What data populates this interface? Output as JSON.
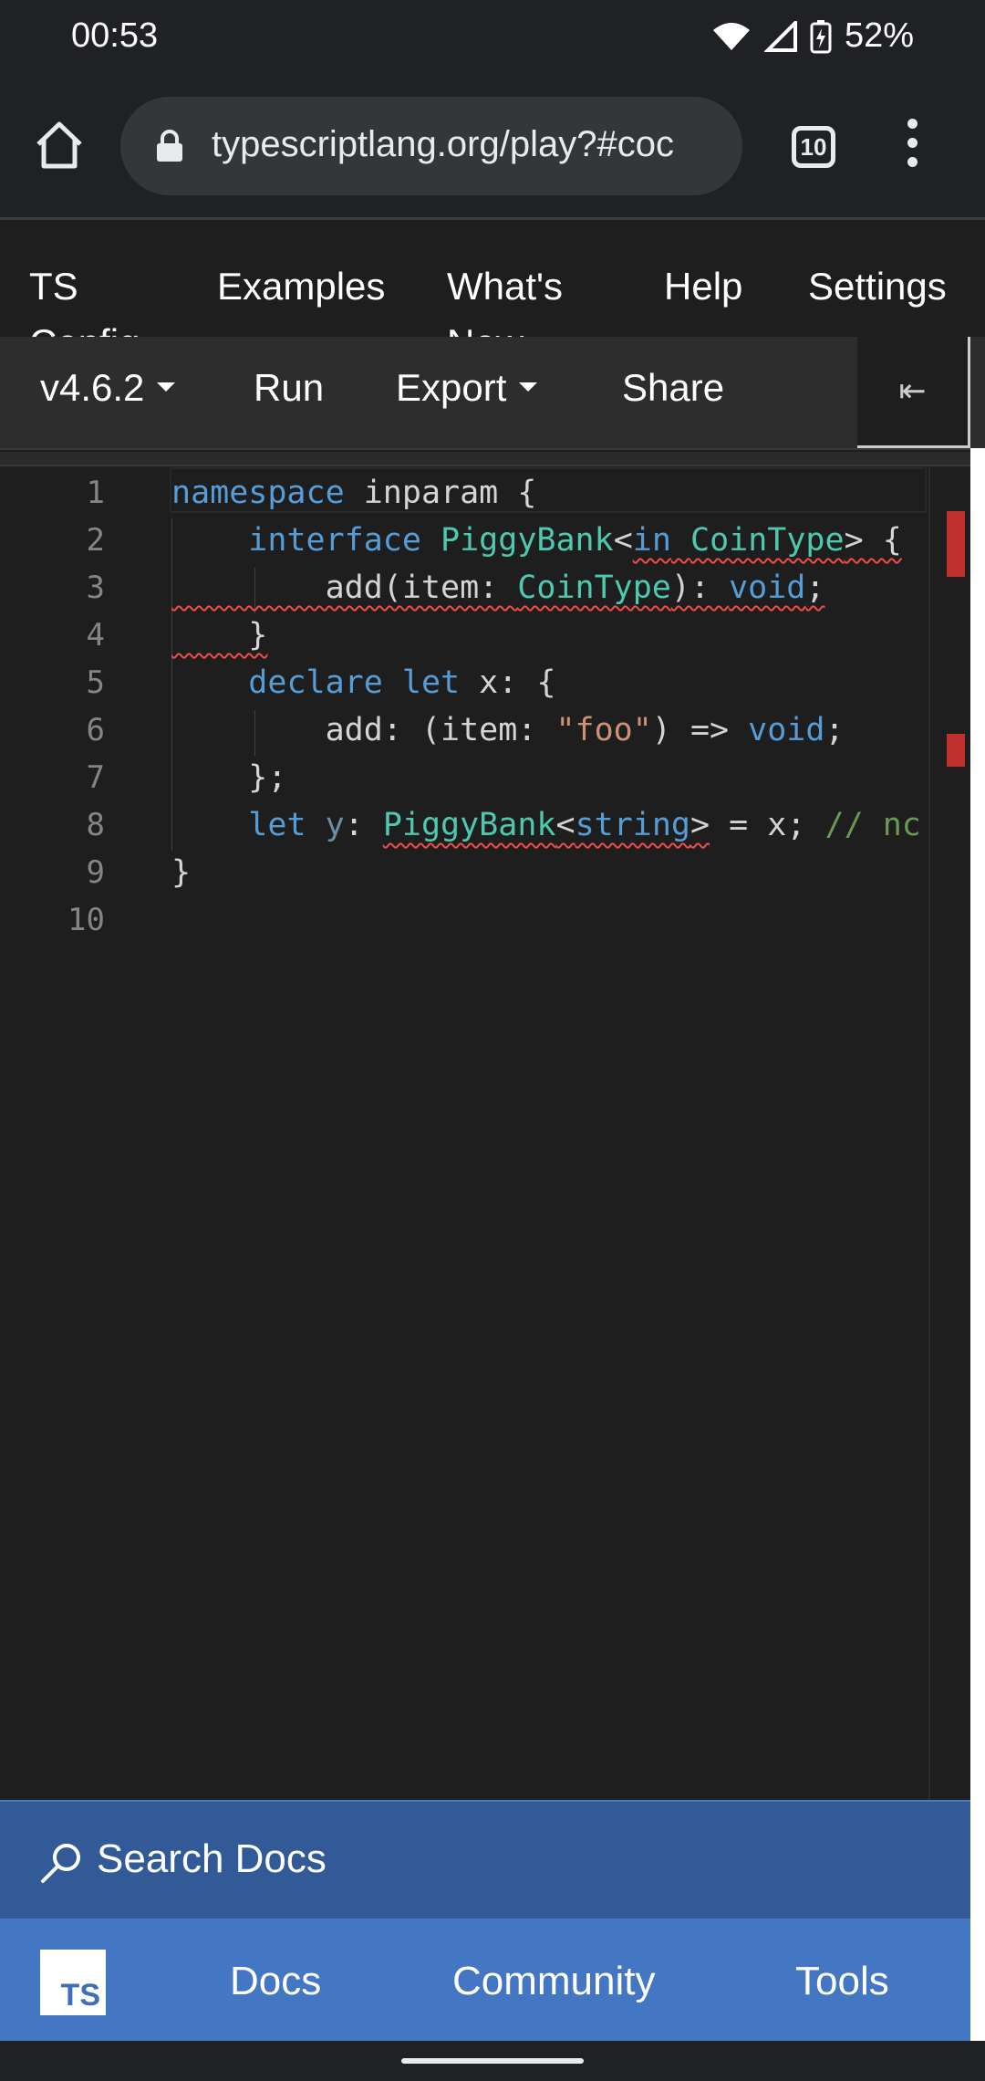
{
  "status_bar": {
    "time": "00:53",
    "battery": "52%"
  },
  "browser": {
    "url": "typescriptlang.org/play?#coc",
    "tab_count": "10"
  },
  "site_nav": {
    "items": [
      "TS Config",
      "Examples",
      "What's New",
      "Help",
      "Settings"
    ]
  },
  "toolbar": {
    "version": "v4.6.2",
    "run": "Run",
    "export": "Export",
    "share": "Share",
    "collapse_glyph": "⇤"
  },
  "editor": {
    "line_numbers": [
      "1",
      "2",
      "3",
      "4",
      "5",
      "6",
      "7",
      "8",
      "9",
      "10"
    ]
  },
  "footer": {
    "search_label": "Search Docs",
    "logo_text": "TS",
    "nav": [
      "Docs",
      "Community",
      "Tools"
    ]
  },
  "colors": {
    "keyword": "#569cd6",
    "type": "#4ec9b0",
    "string": "#ce9178",
    "comment": "#6a9955",
    "error": "#f14c4c",
    "footer_nav": "#4477c3",
    "search_bar": "#325a97"
  }
}
